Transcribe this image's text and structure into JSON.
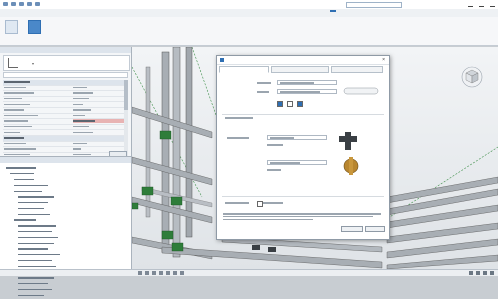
{
  "app": {
    "title": "",
    "search_placeholder": "",
    "signin": ""
  },
  "ribbon": {
    "tabs": [],
    "active_tab": "",
    "modify_label": "",
    "group_label": ""
  },
  "properties": {
    "header": "",
    "selector": "",
    "edit_type": "",
    "apply": ""
  },
  "browser": {
    "header": ""
  },
  "dialog": {
    "title": "",
    "tabs": [],
    "close": "×",
    "ok": "",
    "cancel": ""
  },
  "status": {
    "message": ""
  },
  "colors": {
    "selection_blue": "#2f6fb3",
    "pipe_gray": "#a8aeb4",
    "fitting_green": "#2e7d3a",
    "highlight_red": "#e8b3b3"
  }
}
